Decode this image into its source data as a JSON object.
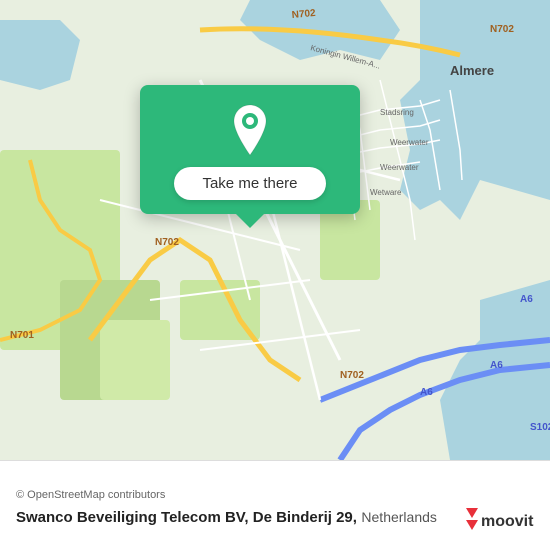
{
  "map": {
    "alt": "Map of Almere, Netherlands area showing De Binderij 29"
  },
  "popup": {
    "button_label": "Take me there"
  },
  "bottom_bar": {
    "osm_credit": "© OpenStreetMap contributors",
    "location_name": "Swanco Beveiliging Telecom BV, De Binderij 29,",
    "location_country": "Netherlands"
  },
  "moovit": {
    "logo_text": "moovit"
  }
}
